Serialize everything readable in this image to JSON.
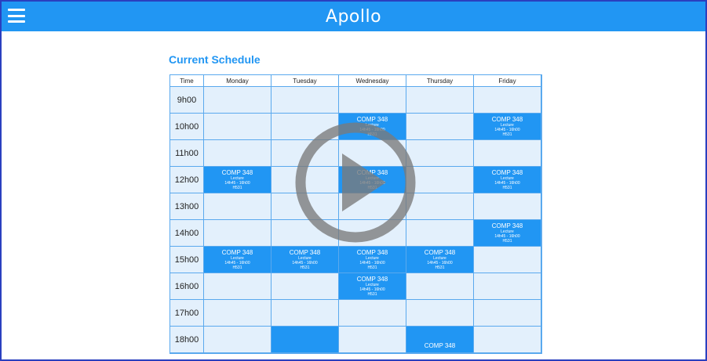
{
  "app": {
    "title": "Apollo"
  },
  "schedule": {
    "title": "Current Schedule",
    "headers": [
      "Time",
      "Monday",
      "Tuesday",
      "Wednesday",
      "Thursday",
      "Friday"
    ],
    "course": {
      "code": "COMP 348",
      "type": "Lecture",
      "time": "14h45 - 16h00",
      "room": "H531"
    },
    "rows": [
      {
        "time": "9h00",
        "slots": [
          false,
          false,
          false,
          false,
          false
        ]
      },
      {
        "time": "10h00",
        "slots": [
          false,
          false,
          true,
          false,
          true
        ]
      },
      {
        "time": "11h00",
        "slots": [
          false,
          false,
          false,
          false,
          false
        ]
      },
      {
        "time": "12h00",
        "slots": [
          true,
          false,
          true,
          false,
          true
        ]
      },
      {
        "time": "13h00",
        "slots": [
          false,
          false,
          false,
          false,
          false
        ]
      },
      {
        "time": "14h00",
        "slots": [
          false,
          false,
          false,
          false,
          true
        ]
      },
      {
        "time": "15h00",
        "slots": [
          true,
          true,
          true,
          true,
          false
        ]
      },
      {
        "time": "16h00",
        "slots": [
          false,
          false,
          true,
          false,
          false
        ]
      },
      {
        "time": "17h00",
        "slots": [
          false,
          false,
          false,
          false,
          false
        ]
      },
      {
        "time": "18h00",
        "slots": [
          false,
          "empty",
          false,
          "header",
          false
        ]
      }
    ]
  },
  "icons": {
    "menu": "hamburger-menu-icon",
    "play": "play-icon"
  },
  "colors": {
    "primary": "#2196f3",
    "cell_bg": "#e3f0fc",
    "border": "#5aa9ee"
  }
}
